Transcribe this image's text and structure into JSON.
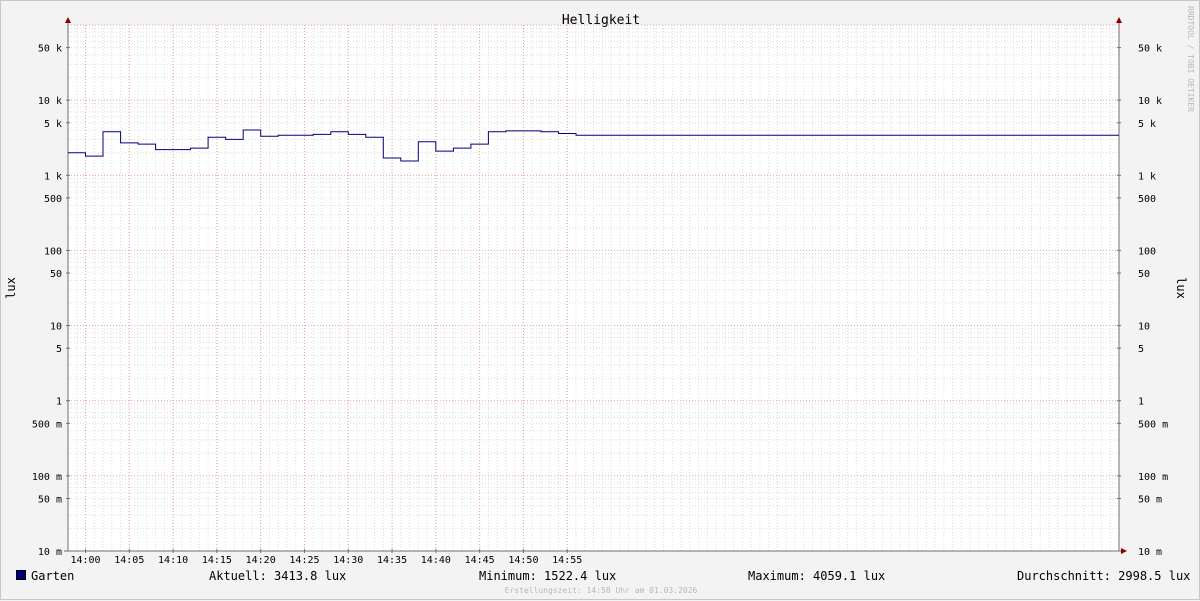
{
  "colors": {
    "background": "#f3f3f3",
    "canvas": "#ffffff",
    "grid_minor": "#dcdcdc",
    "grid_major": "#e8a0a0",
    "axis": "#707070",
    "arrow": "#8b0000",
    "series": "#00007f",
    "watermark": "#b8b8b8"
  },
  "watermark": "RRDTOOL / TOBI OETIKER",
  "legend": {
    "series_name": "Garten",
    "current": "Aktuell: 3413.8 lux",
    "minimum": "Minimum: 1522.4 lux",
    "maximum": "Maximum: 4059.1 lux",
    "average": "Durchschnitt: 2998.5 lux"
  },
  "footer": "Erstellungszeit: 14:58 Uhr am 01.03.2026",
  "chart_data": {
    "type": "line",
    "title": "Helligkeit",
    "ylabel": "lux",
    "ylabel_right": "lux",
    "y_scale": "log",
    "ylim": [
      0.01,
      100000
    ],
    "xlim": [
      "13:58",
      "15:58"
    ],
    "grid": true,
    "legend_position": "bottom",
    "y_ticks": [
      {
        "value": 50000,
        "label": "50 k"
      },
      {
        "value": 10000,
        "label": "10 k"
      },
      {
        "value": 5000,
        "label": "5 k"
      },
      {
        "value": 1000,
        "label": "1 k"
      },
      {
        "value": 500,
        "label": "500"
      },
      {
        "value": 100,
        "label": "100"
      },
      {
        "value": 50,
        "label": "50"
      },
      {
        "value": 10,
        "label": "10"
      },
      {
        "value": 5,
        "label": "5"
      },
      {
        "value": 1,
        "label": "1"
      },
      {
        "value": 0.5,
        "label": "500 m"
      },
      {
        "value": 0.1,
        "label": "100 m"
      },
      {
        "value": 0.05,
        "label": "50 m"
      },
      {
        "value": 0.01,
        "label": "10 m"
      }
    ],
    "x_ticks": [
      "14:00",
      "14:05",
      "14:10",
      "14:15",
      "14:20",
      "14:25",
      "14:30",
      "14:35",
      "14:40",
      "14:45",
      "14:50",
      "14:55"
    ],
    "series": [
      {
        "name": "Garten",
        "step": true,
        "x": [
          "13:58",
          "14:00",
          "14:02",
          "14:04",
          "14:06",
          "14:08",
          "14:10",
          "14:12",
          "14:14",
          "14:16",
          "14:18",
          "14:20",
          "14:22",
          "14:24",
          "14:26",
          "14:28",
          "14:30",
          "14:32",
          "14:34",
          "14:36",
          "14:38",
          "14:40",
          "14:42",
          "14:44",
          "14:46",
          "14:48",
          "14:50",
          "14:52",
          "14:54",
          "14:56",
          "14:58"
        ],
        "values": [
          2000,
          1800,
          3800,
          2700,
          2600,
          2200,
          2200,
          2300,
          3200,
          3000,
          4000,
          3300,
          3400,
          3400,
          3500,
          3800,
          3500,
          3200,
          1700,
          1550,
          2800,
          2100,
          2300,
          2600,
          3800,
          3900,
          3900,
          3800,
          3600,
          3400,
          3400
        ]
      }
    ]
  }
}
